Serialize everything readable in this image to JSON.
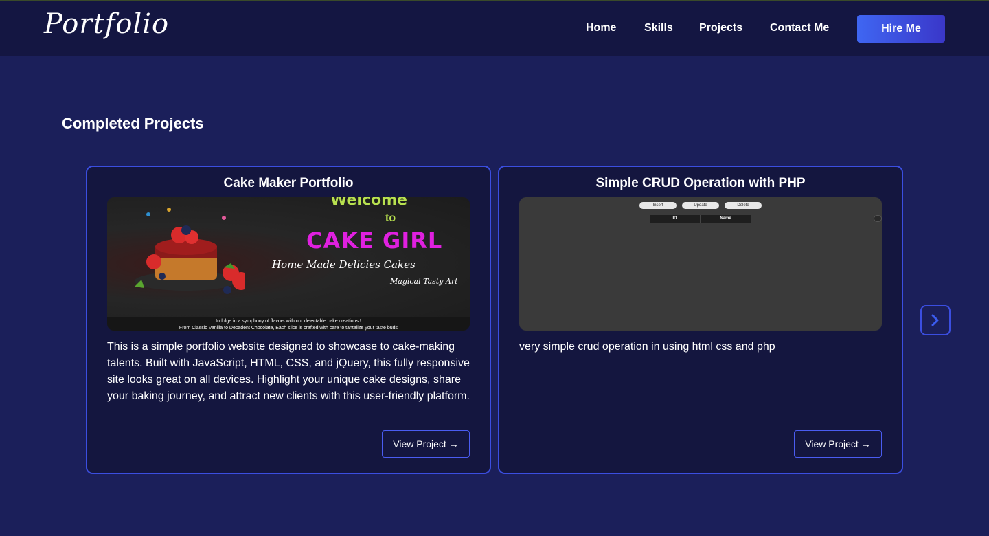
{
  "header": {
    "logo": "Portfolio",
    "nav": [
      "Home",
      "Skills",
      "Projects",
      "Contact Me"
    ],
    "hire_label": "Hire Me"
  },
  "section": {
    "title": "Completed Projects"
  },
  "projects": [
    {
      "title": "Cake Maker Portfolio",
      "image": {
        "welcome": "Welcome",
        "to": "to",
        "brand": "CAKE GIRL",
        "tagline": "Home Made Delicies Cakes",
        "subtagline": "Magical Tasty Art",
        "footer_line1": "Indulge in a symphony of flavors with our delectable cake creations !",
        "footer_line2": "From Classic Vanilla to Decadent Chocolate, Each slice is crafted with care to tantalize your taste buds"
      },
      "description": "This is a simple portfolio website designed to showcase to cake-making talents. Built with JavaScript, HTML, CSS, and jQuery, this fully responsive site looks great on all devices. Highlight your unique cake designs, share your baking journey, and attract new clients with this user-friendly platform.",
      "button": "View Project →"
    },
    {
      "title": "Simple CRUD Operation with PHP",
      "image": {
        "buttons": [
          "Insert",
          "Update",
          "Delete"
        ],
        "columns": [
          "ID",
          "Name"
        ]
      },
      "description": "very simple crud operation in using html css and php",
      "button": "View Project →"
    }
  ],
  "colors": {
    "page_bg": "#1b1f5a",
    "header_bg": "#141642",
    "card_bg": "#14163f",
    "accent": "#3b4ee0",
    "brand_pink": "#e020e0",
    "brand_green": "#b8e14f"
  },
  "icons": {
    "next": "chevron-right-icon"
  }
}
